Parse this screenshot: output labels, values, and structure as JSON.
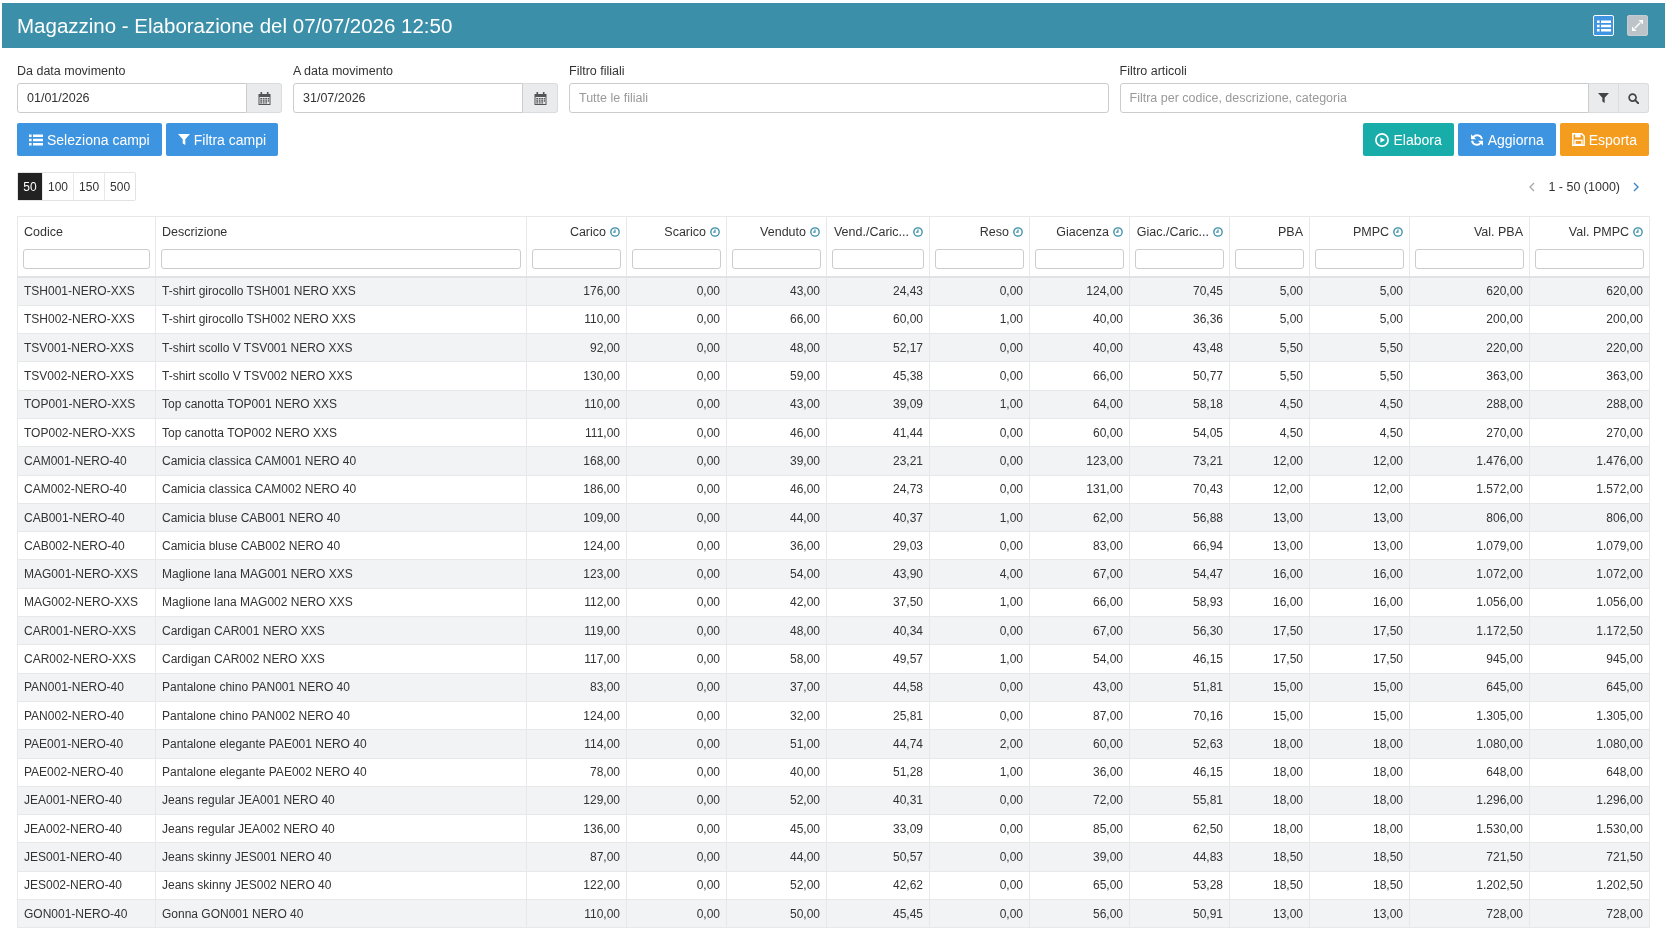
{
  "header": {
    "title": "Magazzino - Elaborazione del 07/07/2026 12:50",
    "buttons": [
      {
        "kind": "list",
        "selected": true
      },
      {
        "kind": "expand",
        "selected": false
      }
    ]
  },
  "filters": [
    {
      "kind": "date",
      "label": "Da data movimento",
      "value": "01/01/2026"
    },
    {
      "kind": "date",
      "label": "A data movimento",
      "value": "31/07/2026"
    },
    {
      "kind": "text",
      "label": "Filtro filiali",
      "placeholder": "Tutte le filiali"
    },
    {
      "kind": "search",
      "label": "Filtro articoli",
      "placeholder": "Filtra per codice, descrizione, categoria"
    }
  ],
  "actions_left": [
    {
      "kind": "fields",
      "label": "Seleziona campi"
    },
    {
      "kind": "filter",
      "label": "Filtra campi"
    }
  ],
  "actions_right": [
    {
      "kind": "run",
      "label": "Elabora"
    },
    {
      "kind": "refresh",
      "label": "Aggiorna"
    },
    {
      "kind": "export",
      "label": "Esporta"
    }
  ],
  "page_sizes": [
    {
      "label": "50",
      "selected": true
    },
    {
      "label": "100",
      "selected": false
    },
    {
      "label": "150",
      "selected": false
    },
    {
      "label": "500",
      "selected": false
    }
  ],
  "pagination": {
    "range": "1 - 50 (1000)",
    "prev_disabled": true,
    "next_disabled": false
  },
  "table": {
    "columns": [
      {
        "label": "Codice",
        "kind": "text",
        "clock_icon": false
      },
      {
        "label": "Descrizione",
        "kind": "text",
        "clock_icon": false
      },
      {
        "label": "Carico",
        "kind": "number",
        "clock_icon": true
      },
      {
        "label": "Scarico",
        "kind": "number",
        "clock_icon": true
      },
      {
        "label": "Venduto",
        "kind": "number",
        "clock_icon": true
      },
      {
        "label": "Vend./Caric...",
        "kind": "number",
        "clock_icon": true
      },
      {
        "label": "Reso",
        "kind": "number",
        "clock_icon": true
      },
      {
        "label": "Giacenza",
        "kind": "number",
        "clock_icon": true
      },
      {
        "label": "Giac./Caric...",
        "kind": "number",
        "clock_icon": true
      },
      {
        "label": "PBA",
        "kind": "number",
        "clock_icon": false
      },
      {
        "label": "PMPC",
        "kind": "number",
        "clock_icon": true
      },
      {
        "label": "Val. PBA",
        "kind": "number",
        "clock_icon": false
      },
      {
        "label": "Val. PMPC",
        "kind": "number",
        "clock_icon": true
      }
    ],
    "rows": [
      [
        "TSH001-NERO-XXS",
        "T-shirt girocollo TSH001 NERO XXS",
        "176,00",
        "0,00",
        "43,00",
        "24,43",
        "0,00",
        "124,00",
        "70,45",
        "5,00",
        "5,00",
        "620,00",
        "620,00"
      ],
      [
        "TSH002-NERO-XXS",
        "T-shirt girocollo TSH002 NERO XXS",
        "110,00",
        "0,00",
        "66,00",
        "60,00",
        "1,00",
        "40,00",
        "36,36",
        "5,00",
        "5,00",
        "200,00",
        "200,00"
      ],
      [
        "TSV001-NERO-XXS",
        "T-shirt scollo V TSV001 NERO XXS",
        "92,00",
        "0,00",
        "48,00",
        "52,17",
        "0,00",
        "40,00",
        "43,48",
        "5,50",
        "5,50",
        "220,00",
        "220,00"
      ],
      [
        "TSV002-NERO-XXS",
        "T-shirt scollo V TSV002 NERO XXS",
        "130,00",
        "0,00",
        "59,00",
        "45,38",
        "0,00",
        "66,00",
        "50,77",
        "5,50",
        "5,50",
        "363,00",
        "363,00"
      ],
      [
        "TOP001-NERO-XXS",
        "Top canotta TOP001 NERO XXS",
        "110,00",
        "0,00",
        "43,00",
        "39,09",
        "1,00",
        "64,00",
        "58,18",
        "4,50",
        "4,50",
        "288,00",
        "288,00"
      ],
      [
        "TOP002-NERO-XXS",
        "Top canotta TOP002 NERO XXS",
        "111,00",
        "0,00",
        "46,00",
        "41,44",
        "0,00",
        "60,00",
        "54,05",
        "4,50",
        "4,50",
        "270,00",
        "270,00"
      ],
      [
        "CAM001-NERO-40",
        "Camicia classica CAM001 NERO 40",
        "168,00",
        "0,00",
        "39,00",
        "23,21",
        "0,00",
        "123,00",
        "73,21",
        "12,00",
        "12,00",
        "1.476,00",
        "1.476,00"
      ],
      [
        "CAM002-NERO-40",
        "Camicia classica CAM002 NERO 40",
        "186,00",
        "0,00",
        "46,00",
        "24,73",
        "0,00",
        "131,00",
        "70,43",
        "12,00",
        "12,00",
        "1.572,00",
        "1.572,00"
      ],
      [
        "CAB001-NERO-40",
        "Camicia bluse CAB001 NERO 40",
        "109,00",
        "0,00",
        "44,00",
        "40,37",
        "1,00",
        "62,00",
        "56,88",
        "13,00",
        "13,00",
        "806,00",
        "806,00"
      ],
      [
        "CAB002-NERO-40",
        "Camicia bluse CAB002 NERO 40",
        "124,00",
        "0,00",
        "36,00",
        "29,03",
        "0,00",
        "83,00",
        "66,94",
        "13,00",
        "13,00",
        "1.079,00",
        "1.079,00"
      ],
      [
        "MAG001-NERO-XXS",
        "Maglione lana MAG001 NERO XXS",
        "123,00",
        "0,00",
        "54,00",
        "43,90",
        "4,00",
        "67,00",
        "54,47",
        "16,00",
        "16,00",
        "1.072,00",
        "1.072,00"
      ],
      [
        "MAG002-NERO-XXS",
        "Maglione lana MAG002 NERO XXS",
        "112,00",
        "0,00",
        "42,00",
        "37,50",
        "1,00",
        "66,00",
        "58,93",
        "16,00",
        "16,00",
        "1.056,00",
        "1.056,00"
      ],
      [
        "CAR001-NERO-XXS",
        "Cardigan CAR001 NERO XXS",
        "119,00",
        "0,00",
        "48,00",
        "40,34",
        "0,00",
        "67,00",
        "56,30",
        "17,50",
        "17,50",
        "1.172,50",
        "1.172,50"
      ],
      [
        "CAR002-NERO-XXS",
        "Cardigan CAR002 NERO XXS",
        "117,00",
        "0,00",
        "58,00",
        "49,57",
        "1,00",
        "54,00",
        "46,15",
        "17,50",
        "17,50",
        "945,00",
        "945,00"
      ],
      [
        "PAN001-NERO-40",
        "Pantalone chino PAN001 NERO 40",
        "83,00",
        "0,00",
        "37,00",
        "44,58",
        "0,00",
        "43,00",
        "51,81",
        "15,00",
        "15,00",
        "645,00",
        "645,00"
      ],
      [
        "PAN002-NERO-40",
        "Pantalone chino PAN002 NERO 40",
        "124,00",
        "0,00",
        "32,00",
        "25,81",
        "0,00",
        "87,00",
        "70,16",
        "15,00",
        "15,00",
        "1.305,00",
        "1.305,00"
      ],
      [
        "PAE001-NERO-40",
        "Pantalone elegante PAE001 NERO 40",
        "114,00",
        "0,00",
        "51,00",
        "44,74",
        "2,00",
        "60,00",
        "52,63",
        "18,00",
        "18,00",
        "1.080,00",
        "1.080,00"
      ],
      [
        "PAE002-NERO-40",
        "Pantalone elegante PAE002 NERO 40",
        "78,00",
        "0,00",
        "40,00",
        "51,28",
        "1,00",
        "36,00",
        "46,15",
        "18,00",
        "18,00",
        "648,00",
        "648,00"
      ],
      [
        "JEA001-NERO-40",
        "Jeans regular JEA001 NERO 40",
        "129,00",
        "0,00",
        "52,00",
        "40,31",
        "0,00",
        "72,00",
        "55,81",
        "18,00",
        "18,00",
        "1.296,00",
        "1.296,00"
      ],
      [
        "JEA002-NERO-40",
        "Jeans regular JEA002 NERO 40",
        "136,00",
        "0,00",
        "45,00",
        "33,09",
        "0,00",
        "85,00",
        "62,50",
        "18,00",
        "18,00",
        "1.530,00",
        "1.530,00"
      ],
      [
        "JES001-NERO-40",
        "Jeans skinny JES001 NERO 40",
        "87,00",
        "0,00",
        "44,00",
        "50,57",
        "0,00",
        "39,00",
        "44,83",
        "18,50",
        "18,50",
        "721,50",
        "721,50"
      ],
      [
        "JES002-NERO-40",
        "Jeans skinny JES002 NERO 40",
        "122,00",
        "0,00",
        "52,00",
        "42,62",
        "0,00",
        "65,00",
        "53,28",
        "18,50",
        "18,50",
        "1.202,50",
        "1.202,50"
      ],
      [
        "GON001-NERO-40",
        "Gonna GON001 NERO 40",
        "110,00",
        "0,00",
        "50,00",
        "45,45",
        "0,00",
        "56,00",
        "50,91",
        "13,00",
        "13,00",
        "728,00",
        "728,00"
      ]
    ]
  }
}
